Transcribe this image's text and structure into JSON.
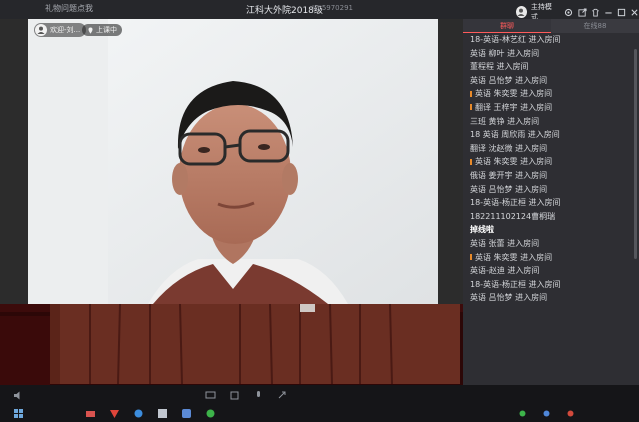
{
  "window": {
    "left_label": "礼物问题点我",
    "title": "江科大外院2018级",
    "room_id": "ID:5970291",
    "host_mode": "主持模式"
  },
  "video": {
    "overlay_user": "欢迎-刘...",
    "status_pill": "上课中"
  },
  "panel": {
    "tabs": [
      {
        "label": "群聊",
        "active": true
      },
      {
        "label": "在线88",
        "active": false
      }
    ],
    "messages": [
      {
        "text": "18-英语-林艺红 进入房间",
        "marked": false,
        "section": false
      },
      {
        "text": "英语 柳叶 进入房间",
        "marked": false,
        "section": false
      },
      {
        "text": "董程程 进入房间",
        "marked": false,
        "section": false
      },
      {
        "text": "英语 吕怡梦 进入房间",
        "marked": false,
        "section": false
      },
      {
        "text": "英语 朱奕雯 进入房间",
        "marked": true,
        "section": false
      },
      {
        "text": "翻译 王梓宇 进入房间",
        "marked": true,
        "section": false
      },
      {
        "text": "三班 黄铮 进入房间",
        "marked": false,
        "section": false
      },
      {
        "text": "18 英语 周欣雨 进入房间",
        "marked": false,
        "section": false
      },
      {
        "text": "翻译 沈赵微 进入房间",
        "marked": false,
        "section": false
      },
      {
        "text": "英语 朱奕雯 进入房间",
        "marked": true,
        "section": false
      },
      {
        "text": "俄语 姜开宇 进入房间",
        "marked": false,
        "section": false
      },
      {
        "text": "英语 吕怡梦 进入房间",
        "marked": false,
        "section": false
      },
      {
        "text": "18-英语-杨正桓 进入房间",
        "marked": false,
        "section": false
      },
      {
        "text": "182211102124曹桐瑞",
        "marked": false,
        "section": false
      },
      {
        "text": "掉线啦",
        "marked": false,
        "section": true
      },
      {
        "text": "英语 张蕾 进入房间",
        "marked": false,
        "section": false
      },
      {
        "text": "英语 朱奕雯 进入房间",
        "marked": true,
        "section": false
      },
      {
        "text": "英语-赵迪 进入房间",
        "marked": false,
        "section": false
      },
      {
        "text": "18-英语-杨正桓 进入房间",
        "marked": false,
        "section": false
      },
      {
        "text": "英语 吕怡梦 进入房间",
        "marked": false,
        "section": false
      }
    ]
  },
  "colors": {
    "accent": "#ff5b5b",
    "marker": "#e88a2a"
  }
}
